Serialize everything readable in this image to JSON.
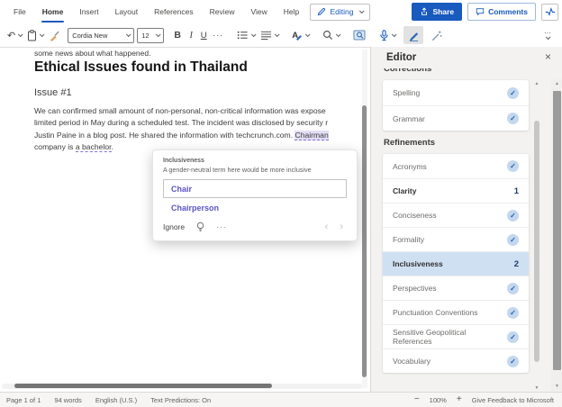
{
  "ribbon": {
    "tabs": [
      "File",
      "Home",
      "Insert",
      "Layout",
      "References",
      "Review",
      "View",
      "Help"
    ],
    "active_tab": "Home",
    "editing_button": "Editing",
    "share_button": "Share",
    "comments_button": "Comments",
    "font_name": "Cordia New",
    "font_size": "12",
    "bold": "B",
    "italic": "I",
    "underline": "U",
    "more": "···",
    "overflow": "···"
  },
  "document": {
    "top_line": "some news about what happened.",
    "title": "Ethical Issues found in Thailand",
    "section_heading": "Issue #1",
    "paragraph": {
      "line1": "We can confirmed small amount of non-personal, non-critical information was expose",
      "line2": "limited period in May during a scheduled test. The incident was disclosed by security r",
      "line3_prefix": "Justin Paine in a blog post. He shared the information with techcrunch.com. ",
      "line3_flagged": "Chairman",
      "line4_prefix": "company is ",
      "line4_flagged": "a bachelor",
      "line4_suffix": "."
    }
  },
  "popup": {
    "title": "Inclusiveness",
    "subtitle": "A gender-neutral term here would be more inclusive",
    "suggestions": [
      "Chair",
      "Chairperson"
    ],
    "ignore_label": "Ignore",
    "more_label": "···"
  },
  "editor_panel": {
    "title": "Editor",
    "corrections_label": "Corrections",
    "corrections": [
      {
        "label": "Spelling",
        "status": "check"
      },
      {
        "label": "Grammar",
        "status": "check"
      }
    ],
    "refinements_label": "Refinements",
    "refinements": [
      {
        "label": "Acronyms",
        "status": "check"
      },
      {
        "label": "Clarity",
        "count": "1"
      },
      {
        "label": "Conciseness",
        "status": "check"
      },
      {
        "label": "Formality",
        "status": "check"
      },
      {
        "label": "Inclusiveness",
        "count": "2",
        "selected": true
      },
      {
        "label": "Perspectives",
        "status": "check"
      },
      {
        "label": "Punctuation Conventions",
        "status": "check"
      },
      {
        "label": "Sensitive Geopolitical References",
        "status": "check"
      },
      {
        "label": "Vocabulary",
        "status": "check"
      }
    ]
  },
  "status_bar": {
    "page": "Page 1 of 1",
    "words": "94 words",
    "language": "English (U.S.)",
    "predictions": "Text Predictions: On",
    "zoom_out": "−",
    "zoom_level": "100%",
    "zoom_in": "+",
    "feedback": "Give Feedback to Microsoft"
  },
  "icons": {
    "undo": "↶",
    "check": "✓",
    "close": "×",
    "prev": "‹",
    "next": "›",
    "up": "▲",
    "down": "▼"
  },
  "colors": {
    "accent": "#185abd",
    "suggestion_purple": "#5a54c6",
    "flag_highlight": "#e4def6",
    "selected_row": "#cfe0f2"
  }
}
